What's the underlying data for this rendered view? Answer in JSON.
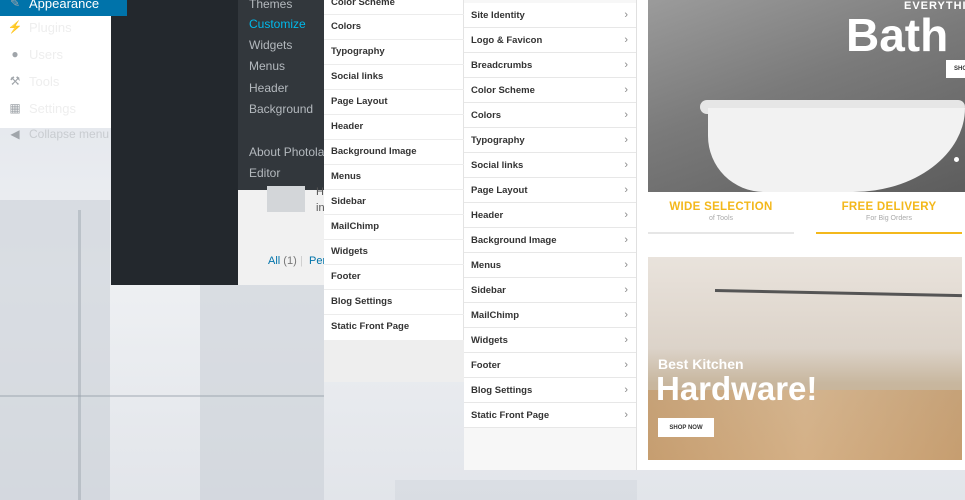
{
  "admin_menu": {
    "items": [
      {
        "label": "Appearance",
        "icon": "brush-icon"
      },
      {
        "label": "Plugins",
        "icon": "plug-icon"
      },
      {
        "label": "Users",
        "icon": "user-icon"
      },
      {
        "label": "Tools",
        "icon": "wrench-icon"
      },
      {
        "label": "Settings",
        "icon": "settings-icon"
      }
    ],
    "collapse_label": "Collapse menu",
    "submenu": [
      "Themes",
      "Customize",
      "Widgets",
      "Menus",
      "Header",
      "Background",
      "About Photolab",
      "Editor"
    ],
    "current_submenu": "Customize",
    "comment_text_1": "H",
    "comment_text_2": "in",
    "filter_all": "All",
    "filter_all_count": "(1)",
    "filter_separator": "|",
    "filter_next": "Per"
  },
  "customizer_left": {
    "items": [
      "Color Scheme",
      "Colors",
      "Typography",
      "Social links",
      "Page Layout",
      "Header",
      "Background Image",
      "Menus",
      "Sidebar",
      "MailChimp",
      "Widgets",
      "Footer",
      "Blog Settings",
      "Static Front Page"
    ]
  },
  "customizer_mid": {
    "items": [
      "Site Identity",
      "Logo & Favicon",
      "Breadcrumbs",
      "Color Scheme",
      "Colors",
      "Typography",
      "Social links",
      "Page Layout",
      "Header",
      "Background Image",
      "Menus",
      "Sidebar",
      "MailChimp",
      "Widgets",
      "Footer",
      "Blog Settings",
      "Static Front Page"
    ],
    "chevron_icon": "chevron-right-icon"
  },
  "preview": {
    "hero_top": "EVERYTHI",
    "hero_title": "Bath",
    "hero_button": "SHO",
    "features": [
      {
        "title": "WIDE SELECTION",
        "subtitle": "of Tools"
      },
      {
        "title": "FREE DELIVERY",
        "subtitle": "For Big Orders"
      }
    ],
    "promo_subtitle": "Best Kitchen",
    "promo_title": "Hardware!",
    "promo_button": "SHOP NOW"
  },
  "colors": {
    "admin_bg": "#23282d",
    "admin_active": "#0073aa",
    "accent_yellow": "#f3b81c"
  }
}
